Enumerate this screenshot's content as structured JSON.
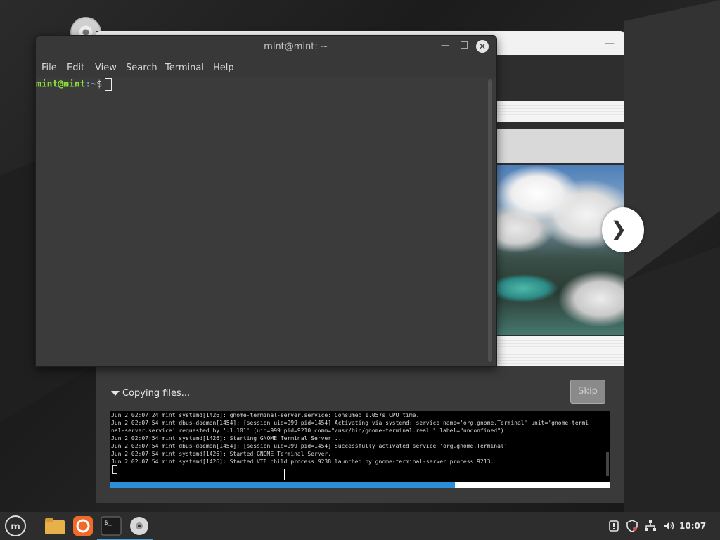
{
  "terminal": {
    "title": "mint@mint: ~",
    "menu": [
      "File",
      "Edit",
      "View",
      "Search",
      "Terminal",
      "Help"
    ],
    "prompt_user": "mint@mint",
    "prompt_path": ":~",
    "prompt_symbol": "$"
  },
  "installer": {
    "copy_label": "Copying files...",
    "skip_label": "Skip",
    "progress": 0.69,
    "log_lines": [
      "Jun  2 02:07:24 mint systemd[1426]: gnome-terminal-server.service: Consumed 1.057s CPU time.",
      "Jun  2 02:07:54 mint dbus-daemon[1454]: [session uid=999 pid=1454] Activating via systemd: service name='org.gnome.Terminal' unit='gnome-termi",
      "nal-server.service' requested by ':1.101' (uid=999 pid=9210 comm=\"/usr/bin/gnome-terminal.real \" label=\"unconfined\")",
      "Jun  2 02:07:54 mint systemd[1426]: Starting GNOME Terminal Server...",
      "Jun  2 02:07:54 mint dbus-daemon[1454]: [session uid=999 pid=1454] Successfully activated service 'org.gnome.Terminal'",
      "Jun  2 02:07:54 mint systemd[1426]: Started GNOME Terminal Server.",
      "Jun  2 02:07:54 mint systemd[1426]: Started VTE child process 9238 launched by gnome-terminal-server process 9213."
    ],
    "slide_next_icon": "chevron-right-icon"
  },
  "taskbar": {
    "apps": [
      "mint-menu-icon",
      "files-icon",
      "firefox-icon",
      "terminal-icon",
      "disc-icon"
    ],
    "clock": "10:07",
    "tray": [
      "updates-icon",
      "shield-icon",
      "network-icon",
      "volume-icon"
    ]
  },
  "colors": {
    "prompt_user": "#8ae234",
    "prompt_path": "#7aa7d9",
    "progress": "#2a8fd8",
    "accent": "#4aa3df"
  }
}
